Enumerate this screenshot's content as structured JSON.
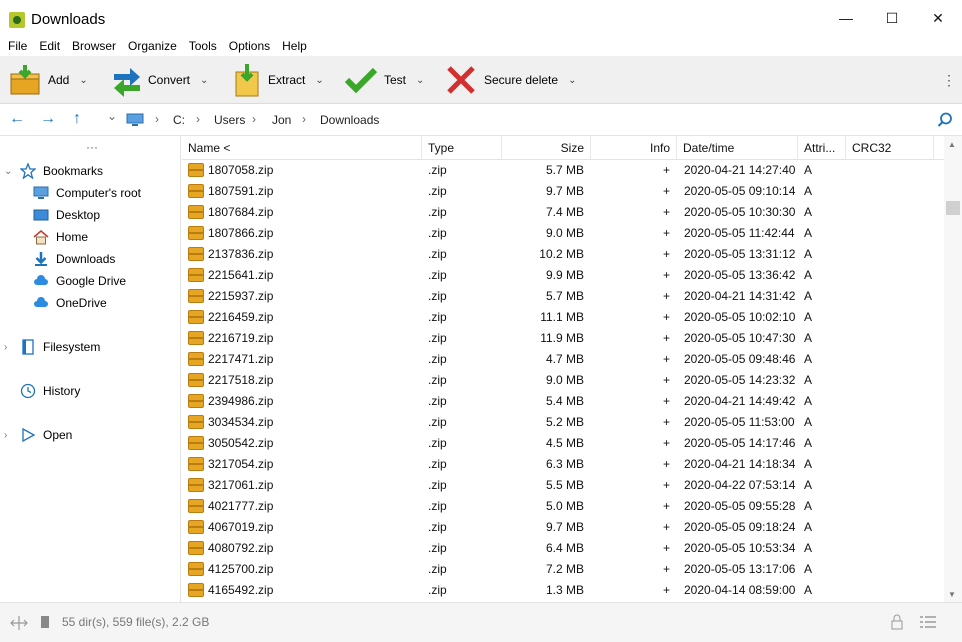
{
  "window": {
    "title": "Downloads",
    "minimize": "—",
    "maximize": "☐",
    "close": "✕"
  },
  "menu": [
    "File",
    "Edit",
    "Browser",
    "Organize",
    "Tools",
    "Options",
    "Help"
  ],
  "toolbar": {
    "add_label": "Add",
    "convert_label": "Convert",
    "extract_label": "Extract",
    "test_label": "Test",
    "secure_delete_label": "Secure delete",
    "caret": "⌄",
    "more": "⋮"
  },
  "address": {
    "back": "←",
    "forward": "→",
    "up": "↑",
    "history": "⌄",
    "sep": "›",
    "crumbs": [
      "C:",
      "Users",
      "Jon",
      "Downloads"
    ]
  },
  "sidebar": {
    "dots": "···",
    "bookmarks": "Bookmarks",
    "items": [
      "Computer's root",
      "Desktop",
      "Home",
      "Downloads",
      "Google Drive",
      "OneDrive"
    ],
    "filesystem": "Filesystem",
    "history": "History",
    "open": "Open"
  },
  "columns": {
    "name": "Name <",
    "type": "Type",
    "size": "Size",
    "info": "Info",
    "datetime": "Date/time",
    "attributes": "Attri...",
    "crc": "CRC32"
  },
  "files": [
    {
      "name": "1807058.zip",
      "type": ".zip",
      "size": "5.7 MB",
      "info": "+",
      "date": "2020-04-21 14:27:40",
      "attr": "A"
    },
    {
      "name": "1807591.zip",
      "type": ".zip",
      "size": "9.7 MB",
      "info": "+",
      "date": "2020-05-05 09:10:14",
      "attr": "A"
    },
    {
      "name": "1807684.zip",
      "type": ".zip",
      "size": "7.4 MB",
      "info": "+",
      "date": "2020-05-05 10:30:30",
      "attr": "A"
    },
    {
      "name": "1807866.zip",
      "type": ".zip",
      "size": "9.0 MB",
      "info": "+",
      "date": "2020-05-05 11:42:44",
      "attr": "A"
    },
    {
      "name": "2137836.zip",
      "type": ".zip",
      "size": "10.2 MB",
      "info": "+",
      "date": "2020-05-05 13:31:12",
      "attr": "A"
    },
    {
      "name": "2215641.zip",
      "type": ".zip",
      "size": "9.9 MB",
      "info": "+",
      "date": "2020-05-05 13:36:42",
      "attr": "A"
    },
    {
      "name": "2215937.zip",
      "type": ".zip",
      "size": "5.7 MB",
      "info": "+",
      "date": "2020-04-21 14:31:42",
      "attr": "A"
    },
    {
      "name": "2216459.zip",
      "type": ".zip",
      "size": "11.1 MB",
      "info": "+",
      "date": "2020-05-05 10:02:10",
      "attr": "A"
    },
    {
      "name": "2216719.zip",
      "type": ".zip",
      "size": "11.9 MB",
      "info": "+",
      "date": "2020-05-05 10:47:30",
      "attr": "A"
    },
    {
      "name": "2217471.zip",
      "type": ".zip",
      "size": "4.7 MB",
      "info": "+",
      "date": "2020-05-05 09:48:46",
      "attr": "A"
    },
    {
      "name": "2217518.zip",
      "type": ".zip",
      "size": "9.0 MB",
      "info": "+",
      "date": "2020-05-05 14:23:32",
      "attr": "A"
    },
    {
      "name": "2394986.zip",
      "type": ".zip",
      "size": "5.4 MB",
      "info": "+",
      "date": "2020-04-21 14:49:42",
      "attr": "A"
    },
    {
      "name": "3034534.zip",
      "type": ".zip",
      "size": "5.2 MB",
      "info": "+",
      "date": "2020-05-05 11:53:00",
      "attr": "A"
    },
    {
      "name": "3050542.zip",
      "type": ".zip",
      "size": "4.5 MB",
      "info": "+",
      "date": "2020-05-05 14:17:46",
      "attr": "A"
    },
    {
      "name": "3217054.zip",
      "type": ".zip",
      "size": "6.3 MB",
      "info": "+",
      "date": "2020-04-21 14:18:34",
      "attr": "A"
    },
    {
      "name": "3217061.zip",
      "type": ".zip",
      "size": "5.5 MB",
      "info": "+",
      "date": "2020-04-22 07:53:14",
      "attr": "A"
    },
    {
      "name": "4021777.zip",
      "type": ".zip",
      "size": "5.0 MB",
      "info": "+",
      "date": "2020-05-05 09:55:28",
      "attr": "A"
    },
    {
      "name": "4067019.zip",
      "type": ".zip",
      "size": "9.7 MB",
      "info": "+",
      "date": "2020-05-05 09:18:24",
      "attr": "A"
    },
    {
      "name": "4080792.zip",
      "type": ".zip",
      "size": "6.4 MB",
      "info": "+",
      "date": "2020-05-05 10:53:34",
      "attr": "A"
    },
    {
      "name": "4125700.zip",
      "type": ".zip",
      "size": "7.2 MB",
      "info": "+",
      "date": "2020-05-05 13:17:06",
      "attr": "A"
    },
    {
      "name": "4165492.zip",
      "type": ".zip",
      "size": "1.3 MB",
      "info": "+",
      "date": "2020-04-14 08:59:00",
      "attr": "A"
    }
  ],
  "status": {
    "text": "55 dir(s), 559 file(s), 2.2 GB"
  },
  "colors": {
    "accent": "#1e73be",
    "folder": "#e6a623",
    "add_green": "#4caf27",
    "delete_red": "#d32f2f"
  }
}
